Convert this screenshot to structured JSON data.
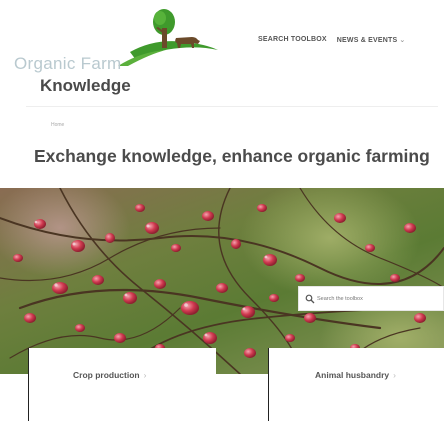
{
  "logo": {
    "line1": "Organic Farm",
    "line2": "Knowledge"
  },
  "nav": {
    "items": [
      {
        "label": "SEARCH TOOLBOX",
        "chevron": ""
      },
      {
        "label": "NEWS & EVENTS",
        "chevron": "⌄"
      }
    ]
  },
  "breadcrumb": {
    "home": "Home"
  },
  "tagline": "Exchange knowledge, enhance organic farming",
  "search": {
    "placeholder": "Search the toolbox"
  },
  "cards": [
    {
      "label": "Crop production",
      "chevron": "›"
    },
    {
      "label": "Animal husbandry",
      "chevron": "›"
    }
  ],
  "colors": {
    "brand_green": "#3f9a2c",
    "tree_brown": "#6b4a2a",
    "logo_light": "#b9c9cf",
    "berry_red": "#c8364a"
  }
}
